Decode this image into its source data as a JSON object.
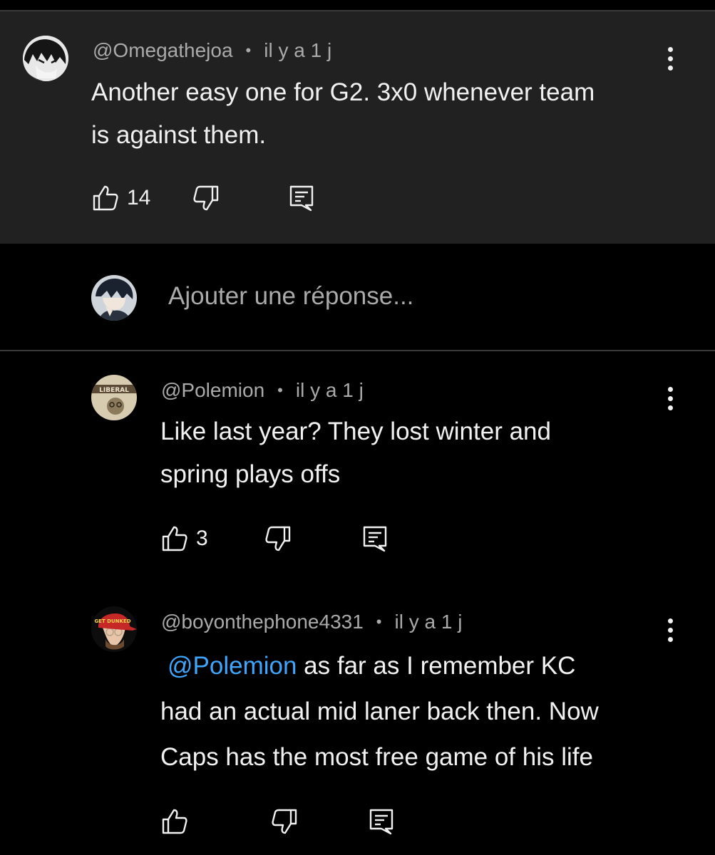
{
  "colors": {
    "background": "#000000",
    "highlight_panel": "#212121",
    "text": "#f1f1f1",
    "muted_text": "#aaaaaa",
    "mention": "#3ea6ff"
  },
  "main_comment": {
    "author": "@Omegathejoa",
    "separator": "•",
    "time": "il y a 1 j",
    "text_line1": "Another easy one for G2. 3x0 whenever team",
    "text_line2": "is against them.",
    "likes": "14",
    "avatar": "anime-character-avatar",
    "icons": {
      "like": "thumbs-up-icon",
      "dislike": "thumbs-down-icon",
      "reply": "reply-icon",
      "more": "more-vert-icon"
    }
  },
  "reply_box": {
    "placeholder": "Ajouter une réponse...",
    "avatar": "user-avatar"
  },
  "replies": [
    {
      "author": "@Polemion",
      "separator": "•",
      "time": "il y a 1 j",
      "text_line1": "Like last year? They lost winter and",
      "text_line2": "spring plays offs",
      "likes": "3",
      "avatar_text": "LIBERAL"
    },
    {
      "author": "@boyonthephone4331",
      "separator": "•",
      "time": "il y a 1 j",
      "mention": "@Polemion",
      "text_line1_rest": " as far as I remember KC",
      "text_line2": "had an actual mid laner back then. Now",
      "text_line3": "Caps has the most free game of his life",
      "likes": "",
      "avatar_cap_text": "GET DUNKED"
    }
  ]
}
